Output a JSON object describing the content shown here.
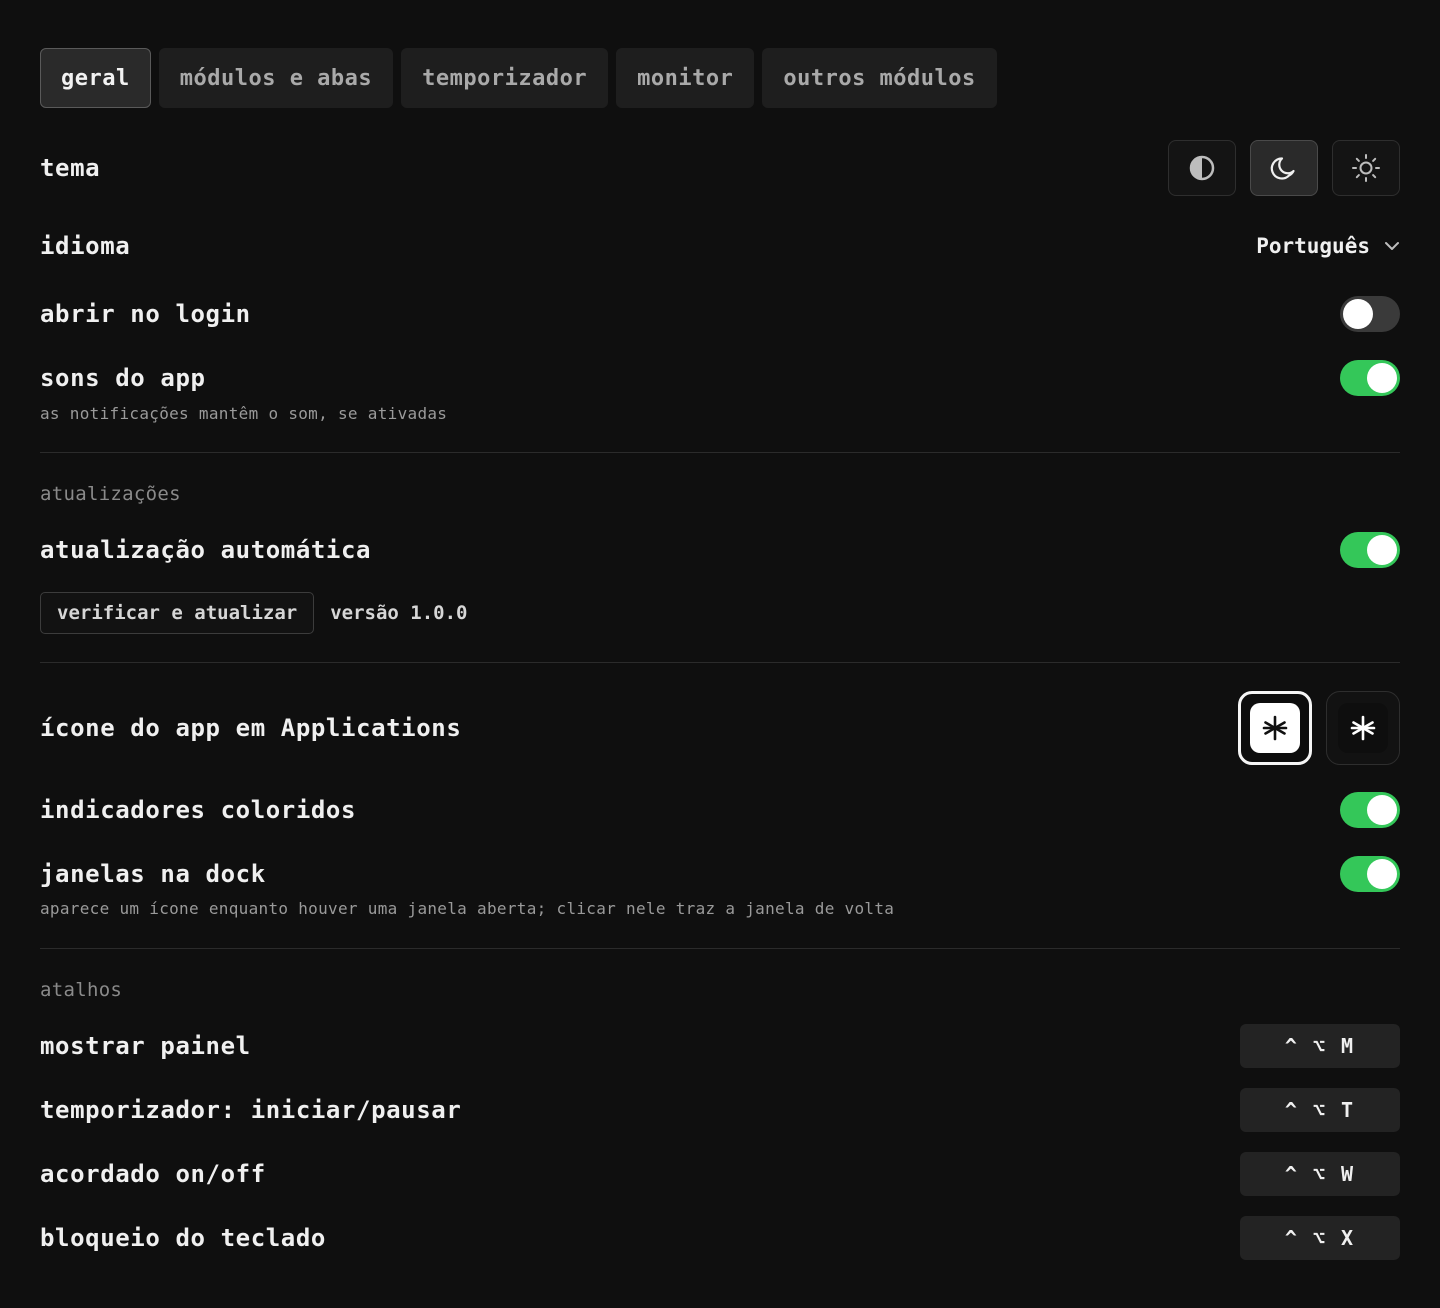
{
  "tabs": [
    {
      "label": "geral",
      "active": true
    },
    {
      "label": "módulos e abas"
    },
    {
      "label": "temporizador"
    },
    {
      "label": "monitor"
    },
    {
      "label": "outros módulos"
    }
  ],
  "general": {
    "theme": {
      "label": "tema",
      "options": [
        "auto-contrast-icon",
        "moon-icon",
        "sun-icon"
      ],
      "selected": "moon-icon"
    },
    "language": {
      "label": "idioma",
      "value": "Português"
    },
    "open_at_login": {
      "label": "abrir no login",
      "enabled": false
    },
    "app_sounds": {
      "label": "sons do app",
      "hint": "as notificações mantêm o som, se ativadas",
      "enabled": true
    }
  },
  "updates": {
    "section_label": "atualizações",
    "auto_update": {
      "label": "atualização automática",
      "enabled": true
    },
    "check_button": "verificar e atualizar",
    "version": "versão 1.0.0"
  },
  "appearance": {
    "app_icon": {
      "label": "ícone do app em Applications",
      "selected": "light"
    },
    "colored_indicators": {
      "label": "indicadores coloridos",
      "enabled": true
    },
    "dock_windows": {
      "label": "janelas na dock",
      "hint": "aparece um ícone enquanto houver uma janela aberta; clicar nele traz a janela de volta",
      "enabled": true
    }
  },
  "shortcuts": {
    "section_label": "atalhos",
    "items": [
      {
        "label": "mostrar painel",
        "keys": "^ ⌥ M"
      },
      {
        "label": "temporizador: iniciar/pausar",
        "keys": "^ ⌥ T"
      },
      {
        "label": "acordado on/off",
        "keys": "^ ⌥ W"
      },
      {
        "label": "bloqueio do teclado",
        "keys": "^ ⌥ X"
      }
    ]
  },
  "colors": {
    "background": "#0f0f0f",
    "toggle_on": "#34c759",
    "toggle_off": "#3a3a3a"
  }
}
